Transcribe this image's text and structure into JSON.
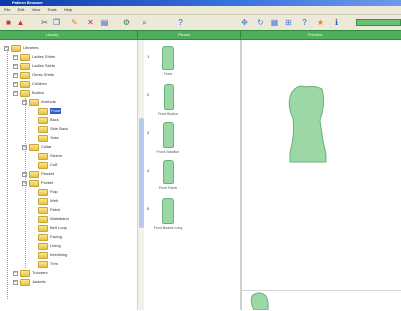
{
  "app": {
    "title": "Pattern Browser",
    "menus": [
      "File",
      "Edit",
      "View",
      "Tools",
      "Help"
    ]
  },
  "toolbar": {
    "icons": [
      "new-icon",
      "open-icon",
      "cut-icon",
      "copy-icon",
      "paste-icon",
      "delete-icon",
      "print-icon",
      "settings-icon",
      "zoom-icon",
      "help-icon"
    ]
  },
  "columns": {
    "tree_header": "Library",
    "thumbs_header": "Pieces",
    "preview_header": "Preview"
  },
  "tree": {
    "items": [
      {
        "label": "Libraries",
        "level": 0
      },
      {
        "label": "Ladies Shirts",
        "level": 1
      },
      {
        "label": "Ladies Skirts",
        "level": 1
      },
      {
        "label": "Gents Shirts",
        "level": 1
      },
      {
        "label": "Children",
        "level": 1
      },
      {
        "label": "Bodice",
        "level": 1
      },
      {
        "label": "Armhole",
        "level": 2
      },
      {
        "label": "Front",
        "level": 3,
        "selected": true
      },
      {
        "label": "Back",
        "level": 3
      },
      {
        "label": "Side Back",
        "level": 3
      },
      {
        "label": "Yoke",
        "level": 3
      },
      {
        "label": "Collar",
        "level": 2
      },
      {
        "label": "Sleeve",
        "level": 3
      },
      {
        "label": "Cuff",
        "level": 3
      },
      {
        "label": "Placket",
        "level": 2
      },
      {
        "label": "Pocket",
        "level": 2
      },
      {
        "label": "Flap",
        "level": 3
      },
      {
        "label": "Welt",
        "level": 3
      },
      {
        "label": "Patch",
        "level": 3
      },
      {
        "label": "Waistband",
        "level": 3
      },
      {
        "label": "Belt Loop",
        "level": 3
      },
      {
        "label": "Facing",
        "level": 3
      },
      {
        "label": "Lining",
        "level": 3
      },
      {
        "label": "Interlining",
        "level": 3
      },
      {
        "label": "Trim",
        "level": 3
      },
      {
        "label": "Trousers",
        "level": 1
      },
      {
        "label": "Jackets",
        "level": 1
      }
    ]
  },
  "pieces": [
    {
      "number": "1",
      "caption": "Front"
    },
    {
      "number": "2",
      "caption": "Front Bodice"
    },
    {
      "number": "3",
      "caption": "Front Variation"
    },
    {
      "number": "4",
      "caption": "Front Panel"
    },
    {
      "number": "5",
      "caption": "Front Bodice Long"
    }
  ],
  "colors": {
    "header_green": "#4fae5c",
    "piece_fill": "#9cd7a6",
    "selection": "#2c5bc9",
    "folder": "#f2d36b"
  }
}
